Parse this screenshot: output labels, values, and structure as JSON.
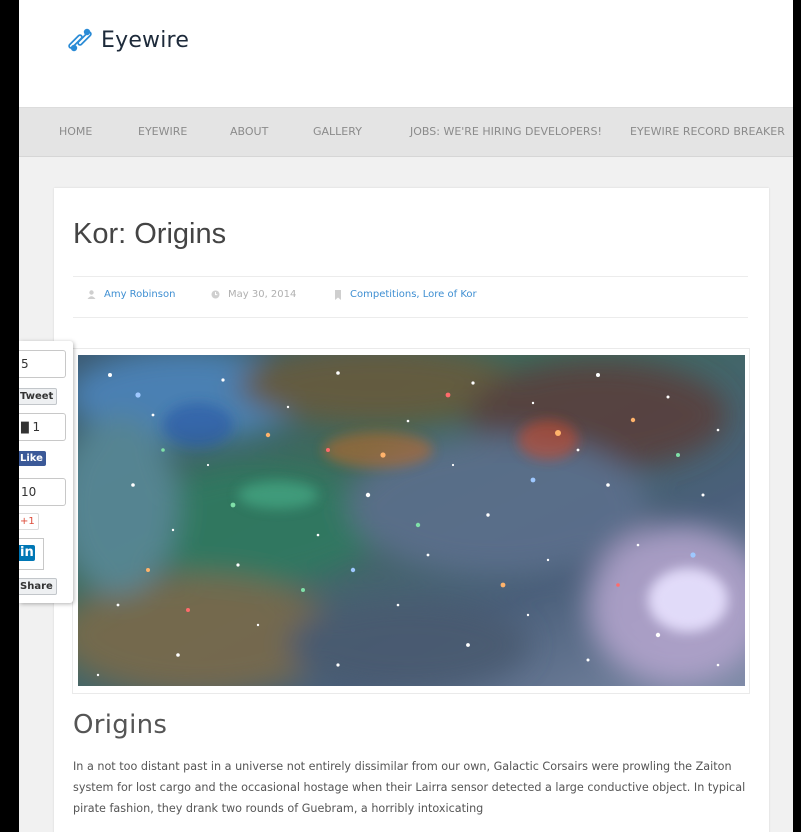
{
  "site": {
    "logo_text": "Eyewire"
  },
  "nav": {
    "items": [
      {
        "label": "HOME"
      },
      {
        "label": "EYEWIRE"
      },
      {
        "label": "ABOUT"
      },
      {
        "label": "GALLERY"
      },
      {
        "label": "JOBS: WE'RE HIRING DEVELOPERS!"
      },
      {
        "label": "EYEWIRE RECORD BREAKER"
      }
    ]
  },
  "post": {
    "title": "Kor: Origins",
    "author": "Amy Robinson",
    "date": "May 30, 2014",
    "categories": "Competitions, Lore of Kor",
    "section_heading": "Origins",
    "body": "In a not too distant past in a universe not entirely dissimilar from our own, Galactic Corsairs were prowling the Zaiton system for lost cargo and the occasional hostage when their Lairra sensor detected a large conductive object. In typical pirate fashion, they drank two rounds of Guebram, a horribly intoxicating"
  },
  "share": {
    "twitter_count": "5",
    "twitter_label": "Tweet",
    "facebook_count": "1",
    "facebook_label": "Like",
    "gplus_count": "10",
    "gplus_label": "+1",
    "linkedin_label": "in",
    "linkedin_share": "Share"
  },
  "colors": {
    "accent_link": "#3f8fd2",
    "brand_blue": "#2a8bd6",
    "nav_background": "#e4e4e4",
    "facebook_blue": "#3b5998",
    "gplus_red": "#dd4b39",
    "linkedin_blue": "#0077b5"
  },
  "icons": {
    "logo": "eyewire-logo-icon",
    "author": "user-icon",
    "date": "clock-icon",
    "category": "bookmark-icon"
  }
}
